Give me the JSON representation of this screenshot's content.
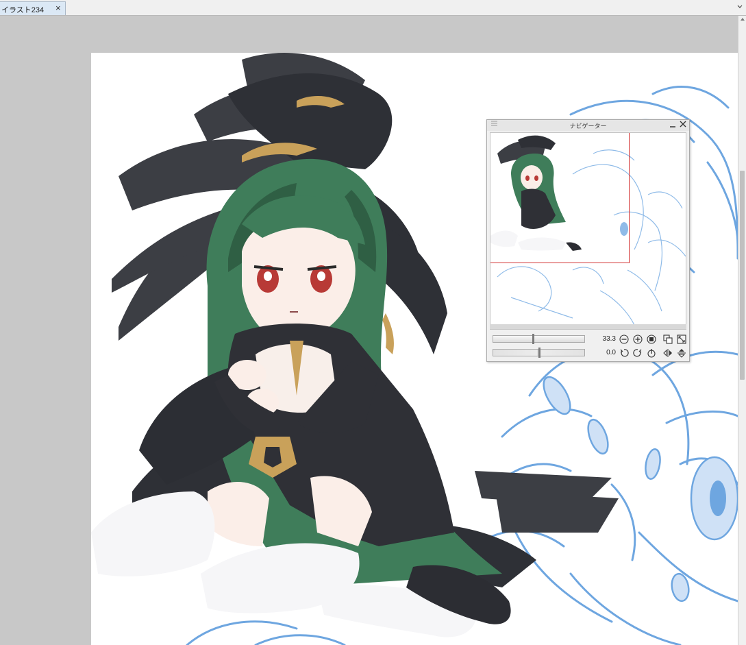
{
  "tabs": [
    {
      "label": "イラスト234",
      "close_icon": "×"
    }
  ],
  "tab_dropdown_icon": "chevron-down-icon",
  "navigator": {
    "title": "ナビゲーター",
    "minimize_icon": "—",
    "close_icon": "×",
    "zoom_value": "33.3",
    "rotation_value": "0.0",
    "zoom_percent": 33.3,
    "rotation_degrees": 0.0
  },
  "colors": {
    "workspace_bg": "#c8c8c8",
    "canvas_bg": "#ffffff",
    "view_frame": "#d23030",
    "sketch_line": "#6ea6e0",
    "hair_green": "#3f7d5a",
    "feather_dark": "#3c3e44",
    "gold_accent": "#c9a15a"
  }
}
